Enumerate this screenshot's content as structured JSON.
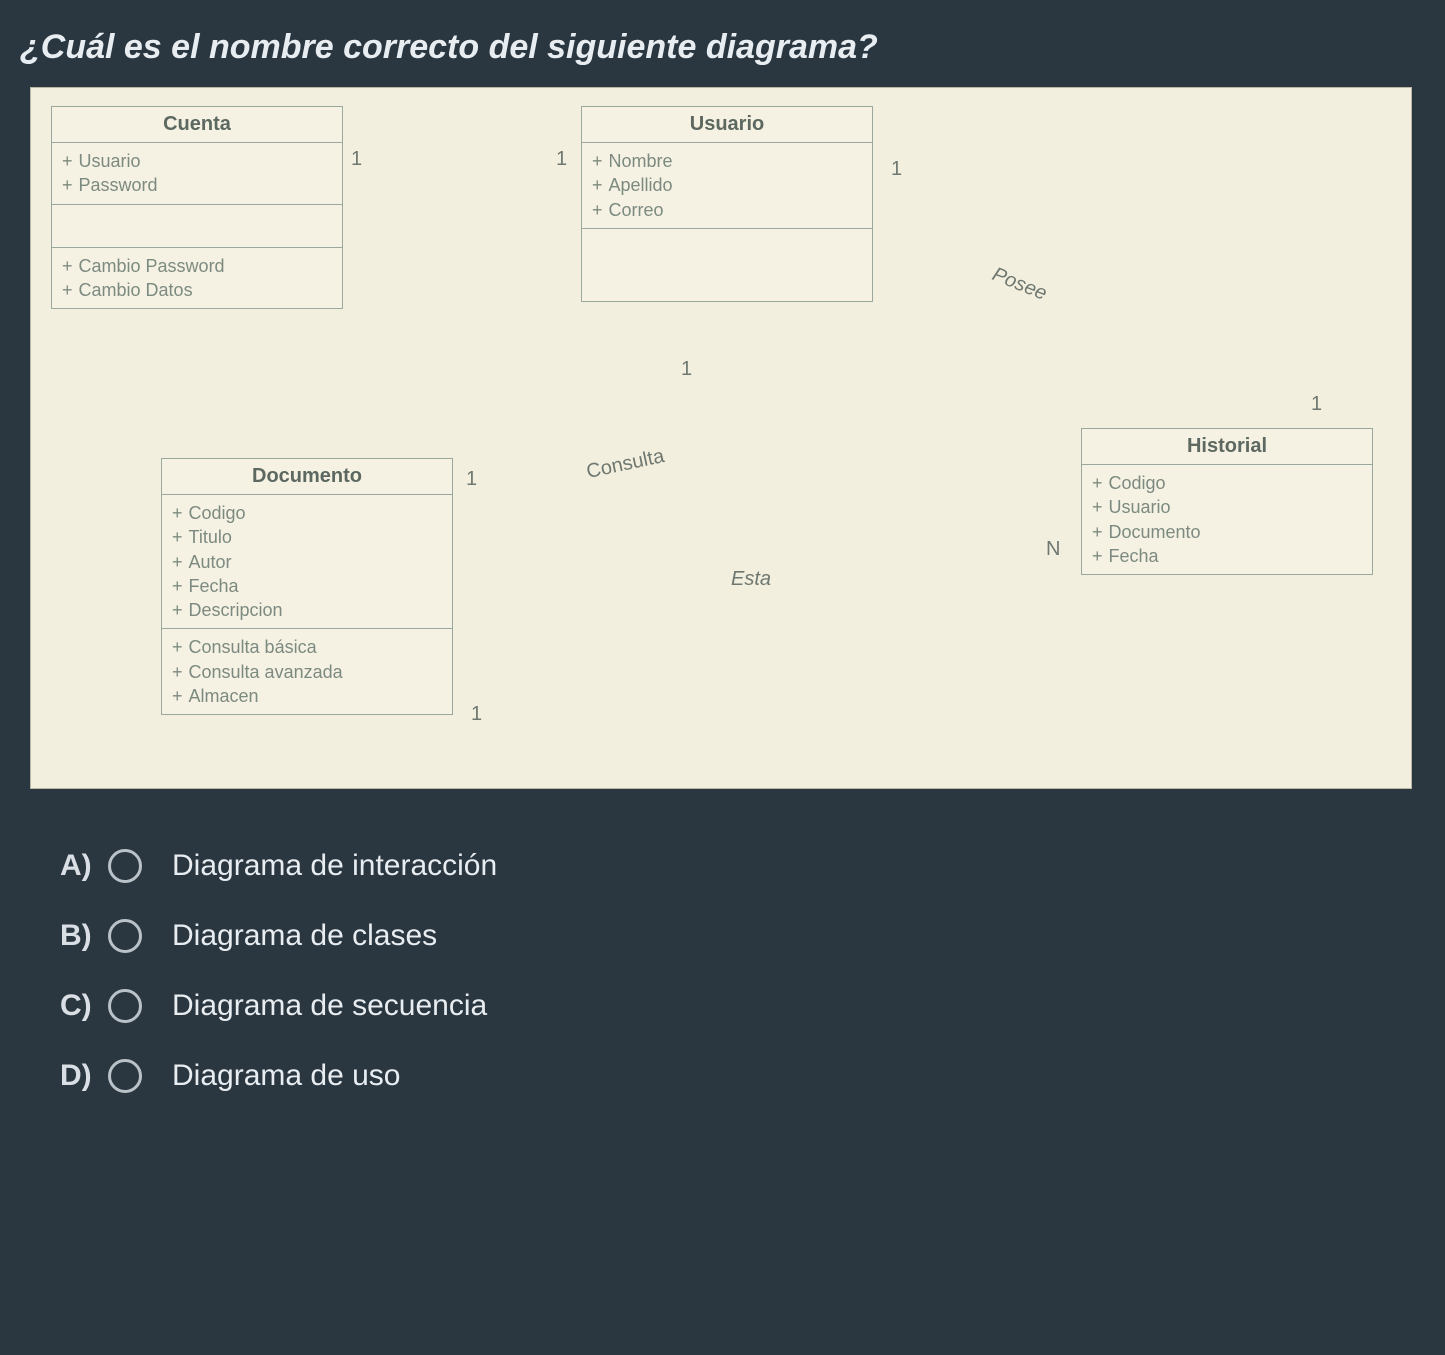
{
  "question": "¿Cuál es el nombre correcto del siguiente diagrama?",
  "classes": {
    "cuenta": {
      "title": "Cuenta",
      "attrs": [
        "Usuario",
        "Password"
      ],
      "ops": [
        "Cambio Password",
        "Cambio Datos"
      ]
    },
    "usuario": {
      "title": "Usuario",
      "attrs": [
        "Nombre",
        "Apellido",
        "Correo"
      ],
      "ops": []
    },
    "documento": {
      "title": "Documento",
      "attrs": [
        "Codigo",
        "Titulo",
        "Autor",
        "Fecha",
        "Descripcion"
      ],
      "ops": [
        "Consulta básica",
        "Consulta avanzada",
        "Almacen"
      ]
    },
    "historial": {
      "title": "Historial",
      "attrs": [
        "Codigo",
        "Usuario",
        "Documento",
        "Fecha"
      ],
      "ops": []
    }
  },
  "assocs": {
    "cuenta_usuario": {
      "left_mult": "1",
      "right_mult": "1",
      "label": ""
    },
    "usuario_documento": {
      "top_mult": "1",
      "label": "Consulta"
    },
    "usuario_historial": {
      "left_mult": "1",
      "right_mult": "1",
      "label": "Posee"
    },
    "documento_historial": {
      "left_mult": "1",
      "right_mult": "N",
      "label": "Esta"
    },
    "documento_self": {
      "mult": "1"
    }
  },
  "options": {
    "a": {
      "letter": "A)",
      "label": "Diagrama de interacción"
    },
    "b": {
      "letter": "B)",
      "label": "Diagrama de clases"
    },
    "c": {
      "letter": "C)",
      "label": "Diagrama de secuencia"
    },
    "d": {
      "letter": "D)",
      "label": "Diagrama de uso"
    }
  },
  "chart_data": {
    "type": "table",
    "description": "UML class diagram",
    "classes": [
      {
        "name": "Cuenta",
        "attributes": [
          "Usuario",
          "Password"
        ],
        "operations": [
          "Cambio Password",
          "Cambio Datos"
        ]
      },
      {
        "name": "Usuario",
        "attributes": [
          "Nombre",
          "Apellido",
          "Correo"
        ],
        "operations": []
      },
      {
        "name": "Documento",
        "attributes": [
          "Codigo",
          "Titulo",
          "Autor",
          "Fecha",
          "Descripcion"
        ],
        "operations": [
          "Consulta básica",
          "Consulta avanzada",
          "Almacen"
        ]
      },
      {
        "name": "Historial",
        "attributes": [
          "Codigo",
          "Usuario",
          "Documento",
          "Fecha"
        ],
        "operations": []
      }
    ],
    "associations": [
      {
        "from": "Cuenta",
        "to": "Usuario",
        "from_mult": "1",
        "to_mult": "1",
        "name": ""
      },
      {
        "from": "Usuario",
        "to": "Documento",
        "from_mult": "1",
        "to_mult": "",
        "name": "Consulta"
      },
      {
        "from": "Usuario",
        "to": "Historial",
        "from_mult": "1",
        "to_mult": "1",
        "name": "Posee"
      },
      {
        "from": "Documento",
        "to": "Historial",
        "from_mult": "1",
        "to_mult": "N",
        "name": "Esta"
      },
      {
        "from": "Documento",
        "to": "Documento",
        "from_mult": "1",
        "to_mult": "",
        "name": ""
      }
    ]
  }
}
